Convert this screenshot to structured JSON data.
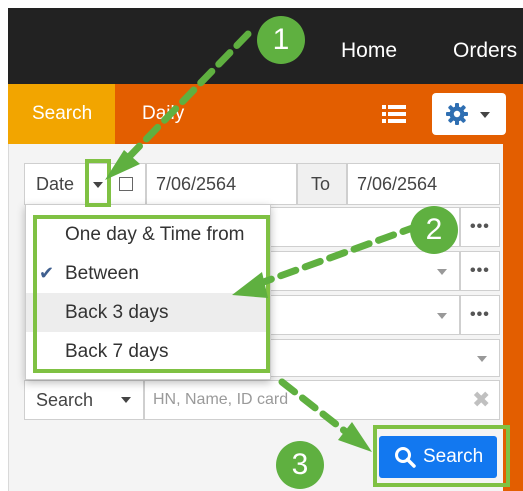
{
  "topnav": {
    "home": "Home",
    "orders": "Orders"
  },
  "tabs": {
    "search": "Search",
    "daily": "Daily"
  },
  "icons": {
    "list": "list-icon",
    "settings": "gear-icon",
    "dropdown": "chevron-down-icon",
    "more": "ellipsis-icon",
    "clear": "close-icon",
    "search": "search-icon",
    "check": "check-icon"
  },
  "filters": {
    "date_label": "Date",
    "date_from": "7/06/2564",
    "to_label": "To",
    "date_to": "7/06/2564",
    "more_label": "•••",
    "search_type": "Search",
    "search_placeholder": "HN, Name, ID card"
  },
  "date_options": [
    {
      "label": "One day & Time from",
      "selected": false
    },
    {
      "label": "Between",
      "selected": true
    },
    {
      "label": "Back 3 days",
      "selected": false
    },
    {
      "label": "Back 7 days",
      "selected": false
    }
  ],
  "search_button": "Search",
  "callouts": [
    "1",
    "2",
    "3"
  ],
  "colors": {
    "topbar": "#222222",
    "tabbar": "#e35e00",
    "active_tab": "#f2a500",
    "primary_button": "#1278f0",
    "callout_green": "#5fb040",
    "check": "#3f5f8f"
  }
}
